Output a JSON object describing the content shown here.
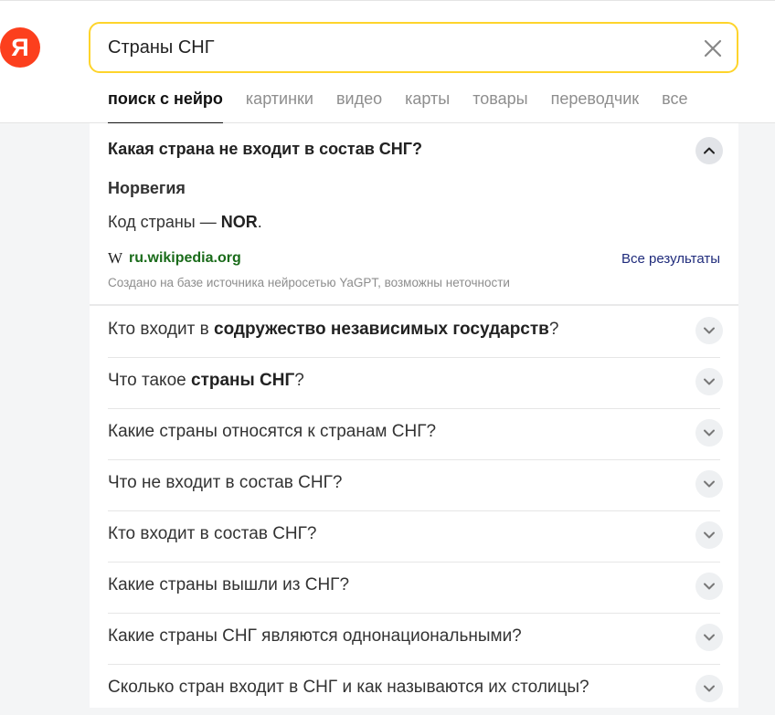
{
  "logo": {
    "letter": "Я"
  },
  "search": {
    "value": "Страны СНГ"
  },
  "tabs": [
    {
      "label": "поиск с нейро",
      "active": true
    },
    {
      "label": "картинки"
    },
    {
      "label": "видео"
    },
    {
      "label": "карты"
    },
    {
      "label": "товары"
    },
    {
      "label": "переводчик"
    },
    {
      "label": "все"
    }
  ],
  "featured": {
    "question": "Какая страна не входит в состав СНГ?",
    "answer_title": "Норвегия",
    "answer_prefix": "Код страны — ",
    "answer_bold": "NOR",
    "answer_suffix": ".",
    "source_icon": "W",
    "source": "ru.wikipedia.org",
    "all_results": "Все результаты",
    "disclaimer": "Создано на базе источника нейросетью YaGPT, возможны неточности"
  },
  "questions": [
    {
      "pre": "Кто входит в ",
      "bold": "содружество независимых государств",
      "post": "?"
    },
    {
      "pre": "Что такое ",
      "bold": "страны СНГ",
      "post": "?"
    },
    {
      "pre": "Какие страны относятся к странам СНГ?",
      "bold": "",
      "post": ""
    },
    {
      "pre": "Что не входит в состав СНГ?",
      "bold": "",
      "post": ""
    },
    {
      "pre": "Кто входит в состав СНГ?",
      "bold": "",
      "post": ""
    },
    {
      "pre": "Какие страны вышли из СНГ?",
      "bold": "",
      "post": ""
    },
    {
      "pre": "Какие страны СНГ являются однонациональными?",
      "bold": "",
      "post": ""
    },
    {
      "pre": "Сколько стран входит в СНГ и как называются их столицы?",
      "bold": "",
      "post": ""
    }
  ]
}
